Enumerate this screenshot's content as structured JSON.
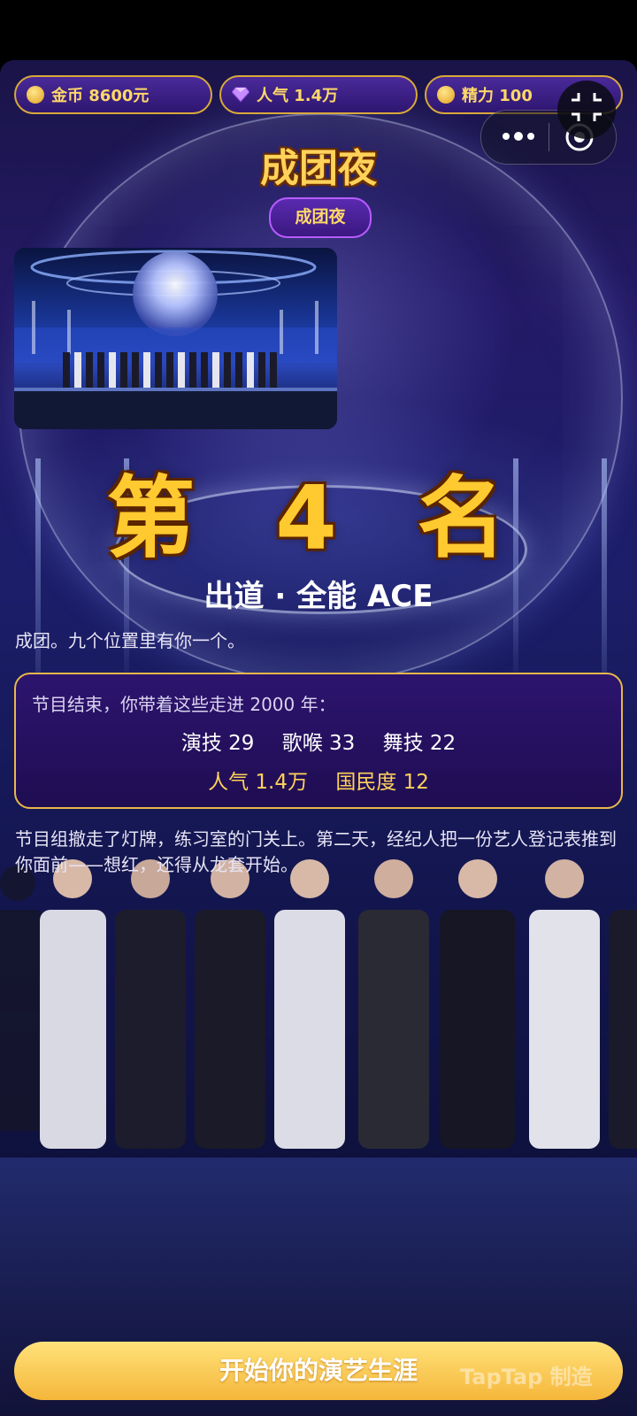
{
  "stats_bar": {
    "gold": {
      "label": "金币 8600元",
      "icon": "coin-icon"
    },
    "popularity": {
      "label": "人气 1.4万",
      "icon": "diamond-icon"
    },
    "energy": {
      "label": "精力 100",
      "icon": "coin-icon"
    }
  },
  "header": {
    "title": "成团夜",
    "tag": "成团夜"
  },
  "result": {
    "rank": "第 4 名",
    "subtitle": "出道 · 全能 ACE",
    "intro": "成团。九个位置里有你一个。",
    "box": {
      "lead": "节目结束，你带着这些走进 2000 年：",
      "skills": [
        "演技 29",
        "歌喉 33",
        "舞技 22"
      ],
      "fame": [
        "人气 1.4万",
        "国民度 12"
      ]
    },
    "outro": "节目组撤走了灯牌，练习室的门关上。第二天，经纪人把一份艺人登记表推到你面前——想红，还得从龙套开始。"
  },
  "cta": {
    "label": "开始你的演艺生涯"
  },
  "watermark": "TapTap 制造",
  "colors": {
    "gold": "#ffd25a",
    "accent_border": "#e8b84a",
    "panel": "#2c146e",
    "cta": "#f5b63a"
  }
}
